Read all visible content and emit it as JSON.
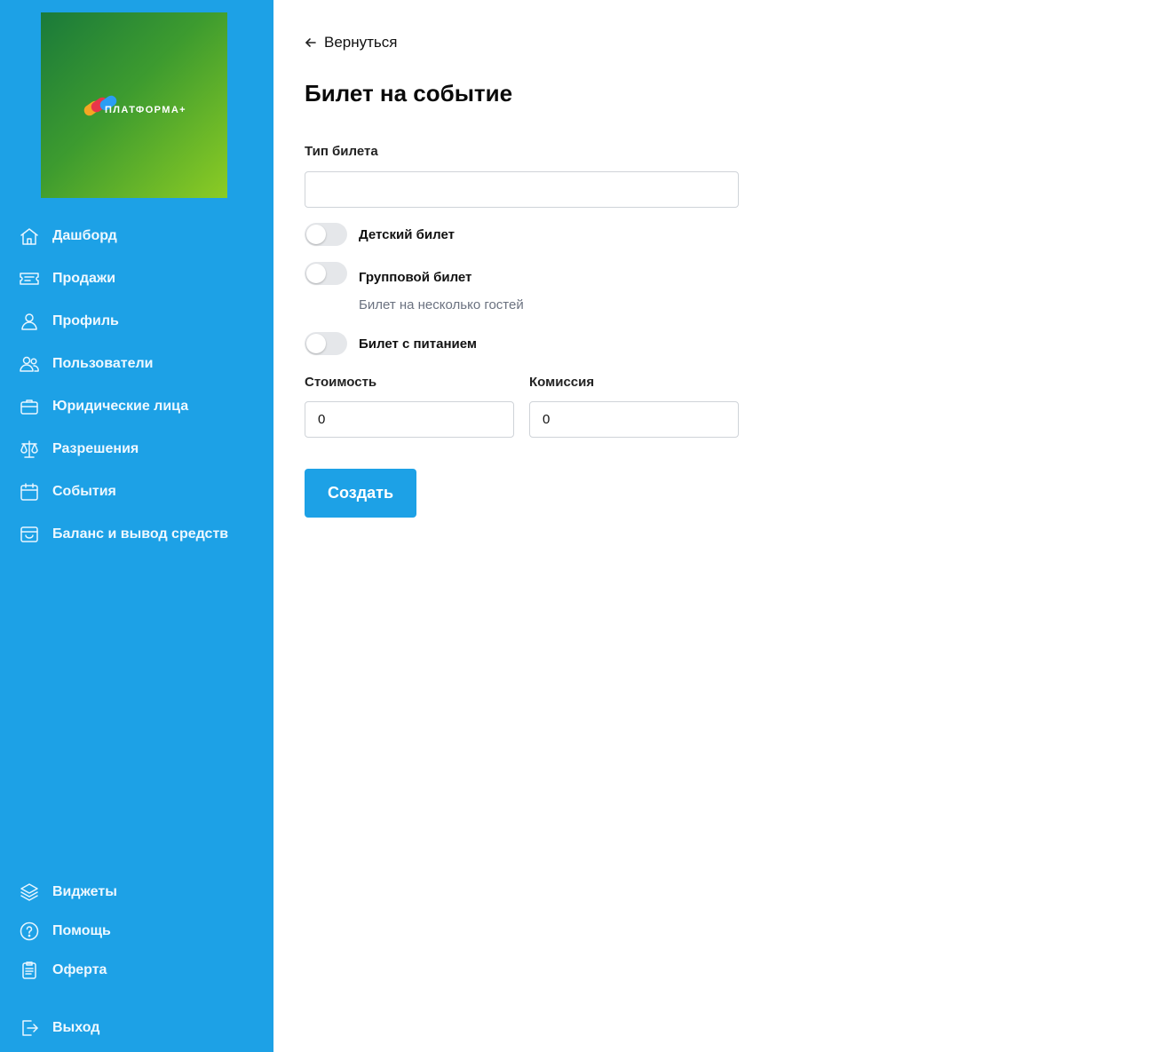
{
  "brand": {
    "logo_text": "ПЛАТФОРМА+"
  },
  "sidebar": {
    "items": [
      {
        "label": "Дашборд",
        "icon": "home-icon"
      },
      {
        "label": "Продажи",
        "icon": "ticket-icon"
      },
      {
        "label": "Профиль",
        "icon": "user-icon"
      },
      {
        "label": "Пользователи",
        "icon": "users-icon"
      },
      {
        "label": "Юридические лица",
        "icon": "briefcase-icon"
      },
      {
        "label": "Разрешения",
        "icon": "scales-icon"
      },
      {
        "label": "События",
        "icon": "calendar-icon"
      },
      {
        "label": "Баланс и вывод средств",
        "icon": "archive-icon"
      }
    ],
    "bottom_items": [
      {
        "label": "Виджеты",
        "icon": "layers-icon"
      },
      {
        "label": "Помощь",
        "icon": "help-icon"
      },
      {
        "label": "Оферта",
        "icon": "document-icon"
      },
      {
        "label": "Выход",
        "icon": "logout-icon"
      }
    ]
  },
  "main": {
    "back_label": "Вернуться",
    "title": "Билет на событие",
    "ticket_type": {
      "label": "Тип билета",
      "value": ""
    },
    "toggles": [
      {
        "label": "Детский билет",
        "checked": false
      },
      {
        "label": "Групповой билет",
        "checked": false,
        "hint": "Билет на несколько гостей"
      },
      {
        "label": "Билет с питанием",
        "checked": false
      }
    ],
    "price": {
      "label": "Стоимость",
      "value": "0"
    },
    "commission": {
      "label": "Комиссия",
      "value": "0"
    },
    "submit_label": "Создать"
  },
  "colors": {
    "sidebar": "#1da1e6",
    "accent": "#1da1e6"
  }
}
